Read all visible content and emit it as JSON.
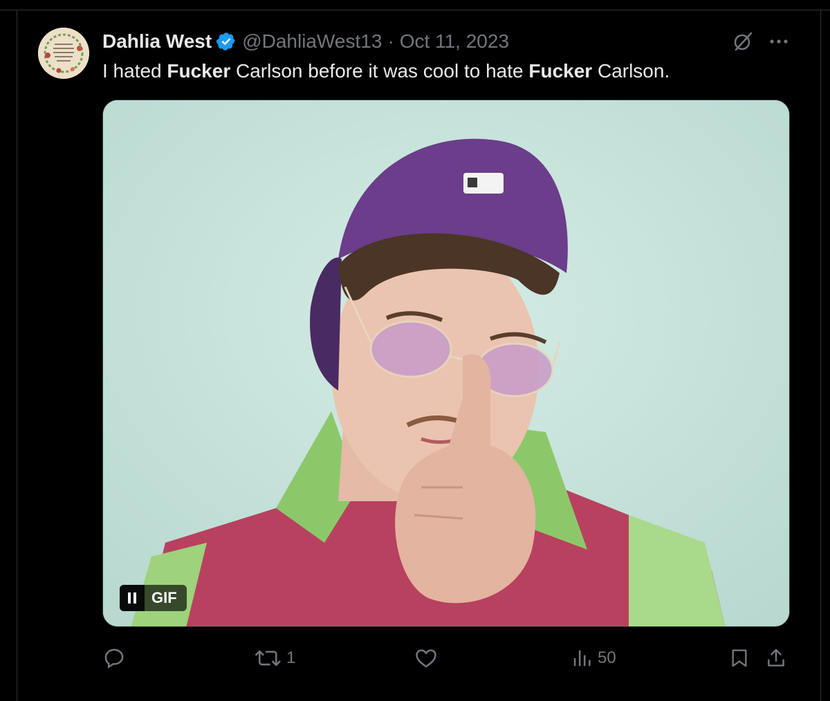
{
  "tweet": {
    "display_name": "Dahlia West",
    "handle": "@DahliaWest13",
    "separator": "·",
    "date": "Oct 11, 2023",
    "text_segments": {
      "s1": "I hated ",
      "s2": "Fucker",
      "s3": " Carlson before it was cool to hate ",
      "s4": "Fucker",
      "s5": " Carlson."
    },
    "verified": true,
    "avatar_icon": "avatar-wreath-quote"
  },
  "media": {
    "type": "gif",
    "badge_label": "GIF",
    "pause_icon": "pause-icon"
  },
  "actions": {
    "reply": {
      "icon": "reply-icon",
      "count": ""
    },
    "repost": {
      "icon": "repost-icon",
      "count": "1"
    },
    "like": {
      "icon": "heart-icon",
      "count": ""
    },
    "views": {
      "icon": "views-icon",
      "count": "50"
    },
    "bookmark": {
      "icon": "bookmark-icon"
    },
    "share": {
      "icon": "share-icon"
    }
  },
  "colors": {
    "background": "#000000",
    "text": "#e7e9ea",
    "secondary": "#71767b",
    "verified": "#1d9bf0"
  }
}
